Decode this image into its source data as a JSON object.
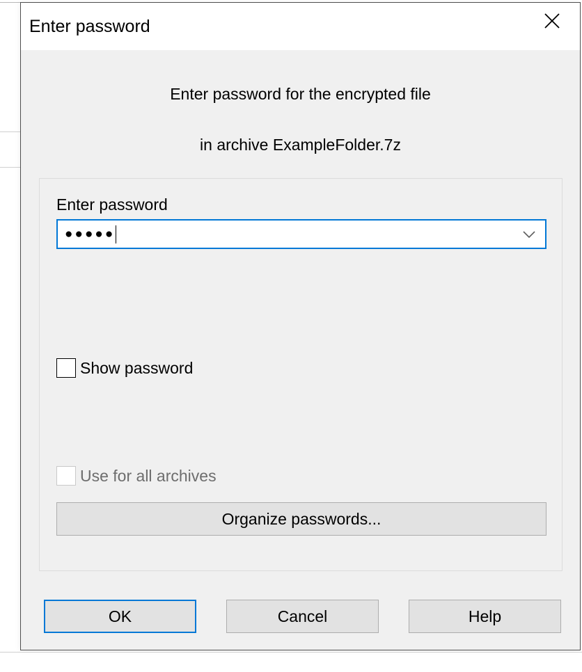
{
  "titlebar": {
    "title": "Enter password"
  },
  "prompt": {
    "line1": "Enter password for the encrypted file",
    "line2": "in archive ExampleFolder.7z"
  },
  "password_field": {
    "label": "Enter password",
    "value_mask": "●●●●●"
  },
  "show_password": {
    "label": "Show password",
    "checked": false
  },
  "use_for_all": {
    "label": "Use for all archives",
    "checked": false,
    "disabled": true
  },
  "organize_button": {
    "label": "Organize passwords..."
  },
  "buttons": {
    "ok": "OK",
    "cancel": "Cancel",
    "help": "Help"
  }
}
